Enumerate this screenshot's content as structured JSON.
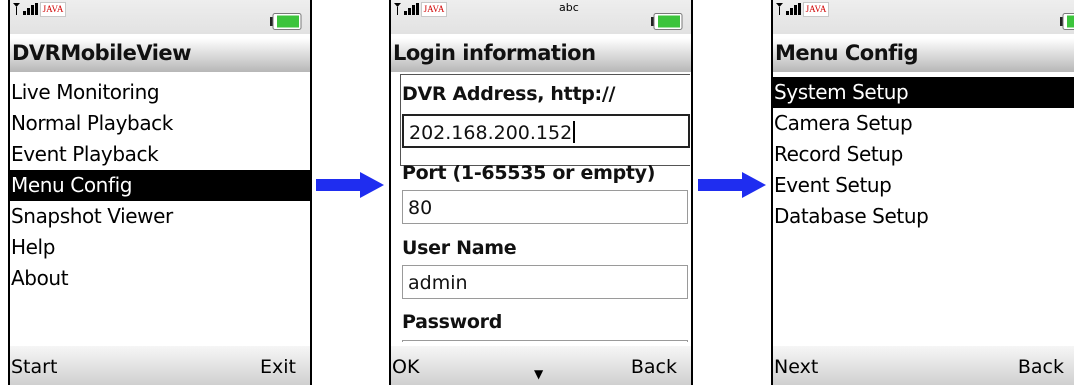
{
  "status_bar": {
    "java_label": "JAVA",
    "abc_label": "abc"
  },
  "screen1": {
    "title": "DVRMobileView",
    "menu": [
      {
        "label": "Live Monitoring",
        "selected": false
      },
      {
        "label": "Normal Playback",
        "selected": false
      },
      {
        "label": "Event Playback",
        "selected": false
      },
      {
        "label": "Menu Config",
        "selected": true
      },
      {
        "label": "Snapshot Viewer",
        "selected": false
      },
      {
        "label": "Help",
        "selected": false
      },
      {
        "label": "About",
        "selected": false
      }
    ],
    "soft_left": "Start",
    "soft_right": "Exit"
  },
  "screen2": {
    "title": "Login information",
    "address_label": "DVR Address, http://",
    "address_value": "202.168.200.152",
    "port_label": "Port (1-65535 or empty)",
    "port_value": "80",
    "user_label": "User Name",
    "user_value": "admin",
    "password_label": "Password",
    "soft_left": "OK",
    "soft_right": "Back"
  },
  "screen3": {
    "title": "Menu Config",
    "menu": [
      {
        "label": "System Setup",
        "selected": true
      },
      {
        "label": "Camera Setup",
        "selected": false
      },
      {
        "label": "Record Setup",
        "selected": false
      },
      {
        "label": "Event Setup",
        "selected": false
      },
      {
        "label": "Database Setup",
        "selected": false
      }
    ],
    "soft_left": "Next",
    "soft_right": "Back"
  },
  "colors": {
    "arrow": "#1f2df0",
    "battery_fill": "#3cc43c",
    "selection_bg": "#000000"
  }
}
